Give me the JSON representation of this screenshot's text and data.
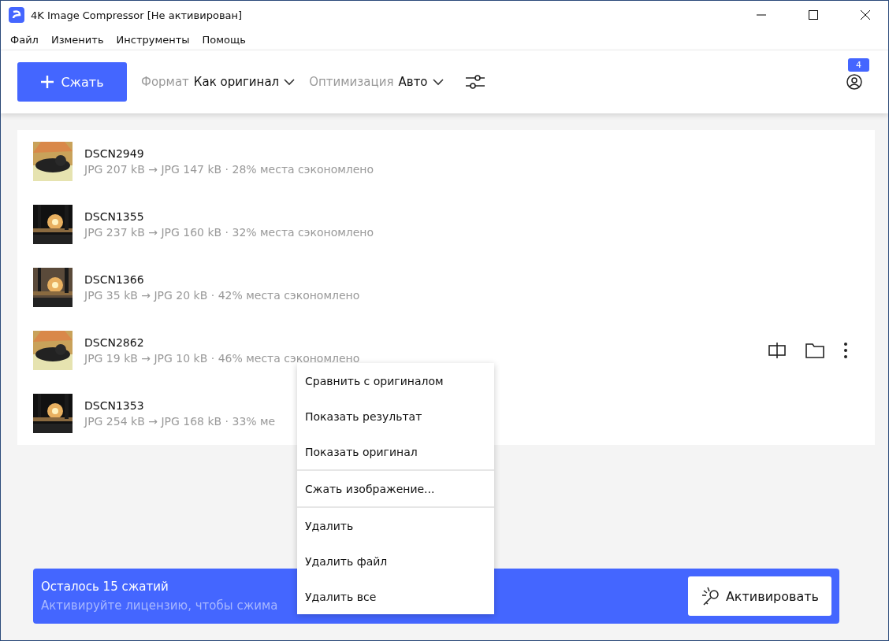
{
  "window": {
    "title": "4K Image Compressor [Не активирован]"
  },
  "menu_bar": [
    "Файл",
    "Изменить",
    "Инструменты",
    "Помощь"
  ],
  "toolbar": {
    "compress_button": "Сжать",
    "format": {
      "label": "Формат",
      "value": "Как оригинал"
    },
    "optimization": {
      "label": "Оптимизация",
      "value": "Авто"
    },
    "notification_count": "4"
  },
  "files": [
    {
      "name": "DSCN2949",
      "details": "JPG 207 kB → JPG 147 kB · 28% места сэкономлено",
      "hovered": false
    },
    {
      "name": "DSCN1355",
      "details": "JPG 237 kB → JPG 160 kB · 32% места сэкономлено",
      "hovered": false
    },
    {
      "name": "DSCN1366",
      "details": "JPG 35 kB → JPG 20 kB · 42% места сэкономлено",
      "hovered": false
    },
    {
      "name": "DSCN2862",
      "details": "JPG 19 kB → JPG 10 kB · 46% места сэкономлено",
      "hovered": true
    },
    {
      "name": "DSCN1353",
      "details": "JPG 254 kB → JPG 168 kB · 33% ме",
      "hovered": false
    }
  ],
  "context_menu": [
    {
      "label": "Сравнить с оригиналом",
      "divider_after": false
    },
    {
      "label": "Показать результат",
      "divider_after": false
    },
    {
      "label": "Показать оригинал",
      "divider_after": true
    },
    {
      "label": "Сжать изображение...",
      "divider_after": true
    },
    {
      "label": "Удалить",
      "divider_after": false
    },
    {
      "label": "Удалить файл",
      "divider_after": false
    },
    {
      "label": "Удалить все",
      "divider_after": false
    }
  ],
  "banner": {
    "title": "Осталось 15 сжатий",
    "subtitle": "Активируйте лицензию, чтобы сжима",
    "button": "Активировать"
  }
}
